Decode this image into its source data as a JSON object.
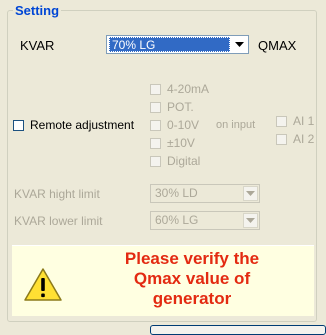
{
  "group": {
    "title": "Setting"
  },
  "kvar": {
    "label": "KVAR",
    "value": "70% LG",
    "unit": "QMAX"
  },
  "remote": {
    "label": "Remote adjustment"
  },
  "signals": [
    {
      "label": "4-20mA"
    },
    {
      "label": "POT."
    },
    {
      "label": "0-10V"
    },
    {
      "label": "±10V"
    },
    {
      "label": "Digital"
    }
  ],
  "on_input_label": "on input",
  "analog_inputs": [
    {
      "label": "AI 1"
    },
    {
      "label": "AI 2"
    }
  ],
  "high_limit": {
    "label": "KVAR hight limit",
    "value": "30% LD"
  },
  "low_limit": {
    "label": "KVAR lower limit",
    "value": "60% LG"
  },
  "warning": {
    "line1": "Please verify the",
    "line2": "Qmax value of",
    "line3": "generator"
  },
  "colors": {
    "title_blue": "#0046D5",
    "warning_red": "#E32A11",
    "selection": "#316AC5"
  }
}
